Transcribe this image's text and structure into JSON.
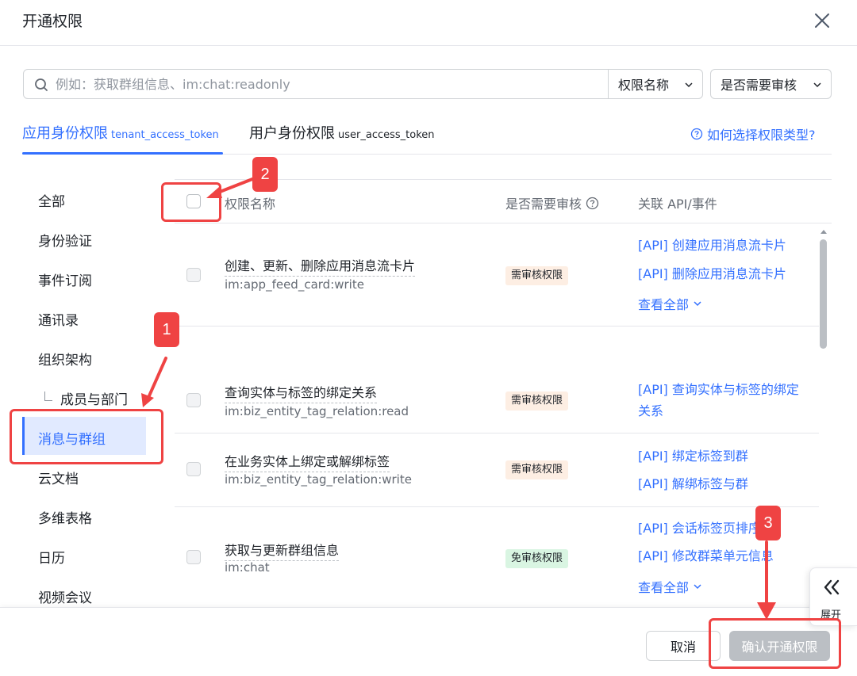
{
  "dialog": {
    "title": "开通权限"
  },
  "search": {
    "placeholder": "例如：获取群组信息、im:chat:readonly",
    "value": ""
  },
  "filters": {
    "name_label": "权限名称",
    "audit_label": "是否需要审核"
  },
  "tabs": [
    {
      "label": "应用身份权限",
      "token": "tenant_access_token",
      "active": true
    },
    {
      "label": "用户身份权限",
      "token": "user_access_token",
      "active": false
    }
  ],
  "help_link": "如何选择权限类型?",
  "sidebar": {
    "items": [
      "全部",
      "身份验证",
      "事件订阅",
      "通讯录",
      "组织架构",
      "成员与部门",
      "消息与群组",
      "云文档",
      "多维表格",
      "日历",
      "视频会议"
    ],
    "active_index": 6
  },
  "table": {
    "headers": {
      "name": "权限名称",
      "audit": "是否需要审核",
      "api": "关联 API/事件"
    },
    "rows": [
      {
        "name": "创建、更新、删除应用消息流卡片",
        "scope": "im:app_feed_card:write",
        "badge": "需审核权限",
        "apis": [
          "[API] 创建应用消息流卡片",
          "[API] 删除应用消息流卡片"
        ],
        "view_all": "查看全部"
      },
      {
        "name": "查询实体与标签的绑定关系",
        "scope": "im:biz_entity_tag_relation:read",
        "badge": "需审核权限",
        "apis": [
          "[API] 查询实体与标签的绑定关系"
        ]
      },
      {
        "name": "在业务实体上绑定或解绑标签",
        "scope": "im:biz_entity_tag_relation:write",
        "badge": "需审核权限",
        "apis": [
          "[API] 绑定标签到群",
          "[API] 解绑标签与群"
        ]
      },
      {
        "name": "获取与更新群组信息",
        "scope": "im:chat",
        "badge": "免审核权限",
        "apis": [
          "[API] 会话标签页排序",
          "[API] 修改群菜单元信息"
        ],
        "view_all": "查看全部"
      }
    ]
  },
  "expand": {
    "label": "展开"
  },
  "footer": {
    "cancel_label": "取消",
    "confirm_label": "确认开通权限"
  },
  "annotations": [
    {
      "number": "1",
      "target": "sidebar-item-messages-groups"
    },
    {
      "number": "2",
      "target": "select-all-checkbox"
    },
    {
      "number": "3",
      "target": "confirm-button"
    }
  ],
  "colors": {
    "accent": "#3370ff",
    "annotation": "#ef4343",
    "disabled_button": "#bbbfc4",
    "badge_review_bg": "#fdeee3",
    "badge_free_bg": "#d9f5e2"
  }
}
